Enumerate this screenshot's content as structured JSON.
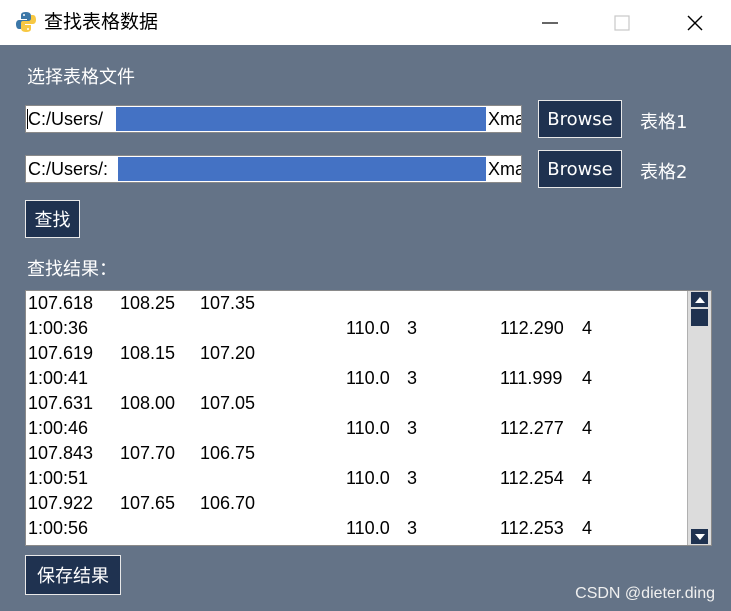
{
  "window": {
    "title": "查找表格数据",
    "icon": "python-icon",
    "controls": [
      "minimize-icon",
      "maximize-icon",
      "close-icon"
    ]
  },
  "section_label": "选择表格文件",
  "files": [
    {
      "path_prefix": "C:/Users/",
      "path_suffix": "Xma",
      "browse_label": "Browse",
      "table_label": "表格1"
    },
    {
      "path_prefix": "C:/Users/:",
      "path_suffix": "Xma",
      "browse_label": "Browse",
      "table_label": "表格2"
    }
  ],
  "search_button": "查找",
  "results_label": "查找结果：",
  "results": [
    {
      "a": "107.618",
      "b": "108.25",
      "c": "107.35"
    },
    {
      "time": "1:00:36",
      "d": "110.0",
      "e": "3",
      "f": "112.290",
      "g": "4"
    },
    {
      "a": "107.619",
      "b": "108.15",
      "c": "107.20"
    },
    {
      "time": "1:00:41",
      "d": "110.0",
      "e": "3",
      "f": "111.999",
      "g": "4"
    },
    {
      "a": "107.631",
      "b": "108.00",
      "c": "107.05"
    },
    {
      "time": "1:00:46",
      "d": "110.0",
      "e": "3",
      "f": "112.277",
      "g": "4"
    },
    {
      "a": "107.843",
      "b": "107.70",
      "c": "106.75"
    },
    {
      "time": "1:00:51",
      "d": "110.0",
      "e": "3",
      "f": "112.254",
      "g": "4"
    },
    {
      "a": "107.922",
      "b": "107.65",
      "c": "106.70"
    },
    {
      "time": "1:00:56",
      "d": "110.0",
      "e": "3",
      "f": "112.253",
      "g": "4"
    }
  ],
  "save_button": "保存结果",
  "watermark": "CSDN @dieter.ding",
  "colors": {
    "background": "#647387",
    "button": "#1f3250",
    "selection": "#4472c4"
  }
}
